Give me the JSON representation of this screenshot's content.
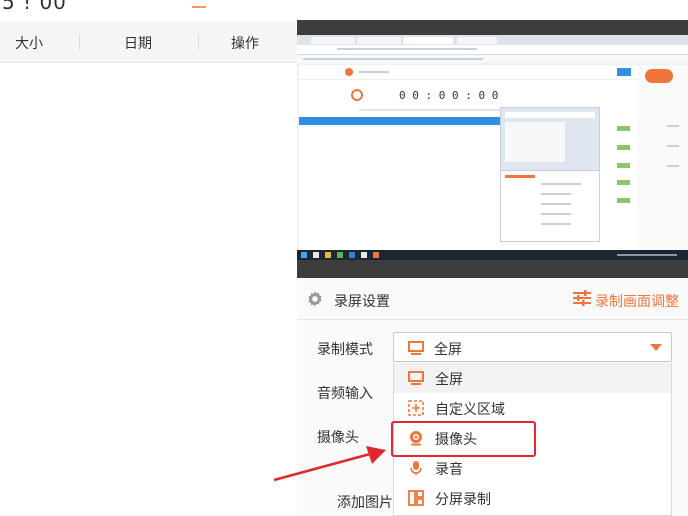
{
  "top_partial": "5 ! 00",
  "file_list": {
    "columns": [
      "大小",
      "日期",
      "操作"
    ]
  },
  "settings": {
    "title": "录屏设置",
    "adjust_label": "录制画面调整",
    "labels": {
      "mode": "录制模式",
      "audio": "音频输入",
      "camera": "摄像头",
      "add_image": "添加图片"
    },
    "mode_select": {
      "value": "全屏",
      "icon": "monitor-icon",
      "options": [
        {
          "label": "全屏",
          "icon": "monitor-icon"
        },
        {
          "label": "自定义区域",
          "icon": "custom-region-icon"
        },
        {
          "label": "摄像头",
          "icon": "webcam-icon"
        },
        {
          "label": "录音",
          "icon": "microphone-icon"
        },
        {
          "label": "分屏录制",
          "icon": "split-screen-icon"
        }
      ],
      "hovered_option": "全屏",
      "highlighted_option": "摄像头"
    }
  },
  "colors": {
    "accent": "#f0753a",
    "highlight_box": "#e0282e",
    "preview_bg": "#3d3d3d"
  }
}
